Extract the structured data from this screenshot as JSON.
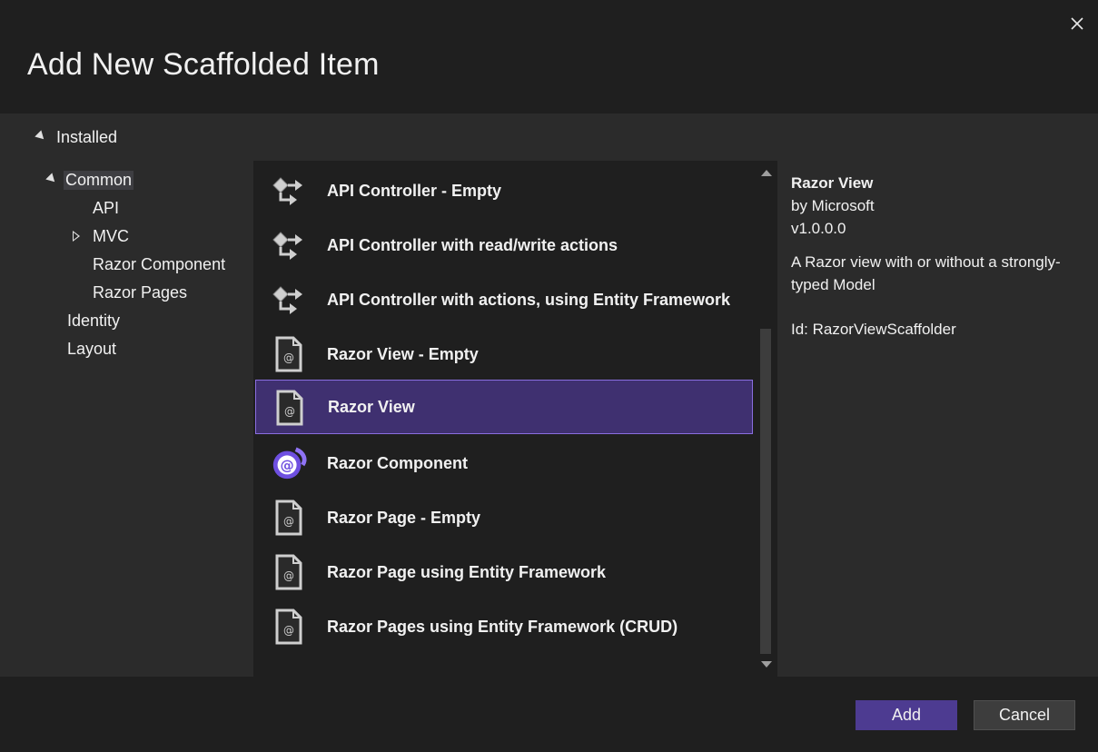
{
  "dialog": {
    "title": "Add New Scaffolded Item"
  },
  "tree": {
    "installed_label": "Installed",
    "common_label": "Common",
    "children": [
      "API",
      "MVC",
      "Razor Component",
      "Razor Pages"
    ],
    "identity_label": "Identity",
    "layout_label": "Layout",
    "selected": "Common"
  },
  "list": {
    "items": [
      {
        "label": "API Controller - Empty",
        "icon": "api-controller-icon"
      },
      {
        "label": "API Controller with read/write actions",
        "icon": "api-controller-icon"
      },
      {
        "label": "API Controller with actions, using Entity Framework",
        "icon": "api-controller-icon"
      },
      {
        "label": "Razor View - Empty",
        "icon": "razor-file-icon"
      },
      {
        "label": "Razor View",
        "icon": "razor-file-icon"
      },
      {
        "label": "Razor Component",
        "icon": "blazor-icon"
      },
      {
        "label": "Razor Page - Empty",
        "icon": "razor-file-icon"
      },
      {
        "label": "Razor Page using Entity Framework",
        "icon": "razor-file-icon"
      },
      {
        "label": "Razor Pages using Entity Framework (CRUD)",
        "icon": "razor-file-icon"
      }
    ],
    "selected_index": 4
  },
  "details": {
    "title": "Razor View",
    "author": "by Microsoft",
    "version": "v1.0.0.0",
    "description": "A Razor view with or without a strongly-typed Model",
    "id": "Id: RazorViewScaffolder"
  },
  "footer": {
    "add_label": "Add",
    "cancel_label": "Cancel"
  },
  "colors": {
    "accent": "#4d3b91",
    "selection": "#3f3070",
    "selection_border": "#8a6ee0",
    "blazor_purple": "#7b5cf0"
  }
}
